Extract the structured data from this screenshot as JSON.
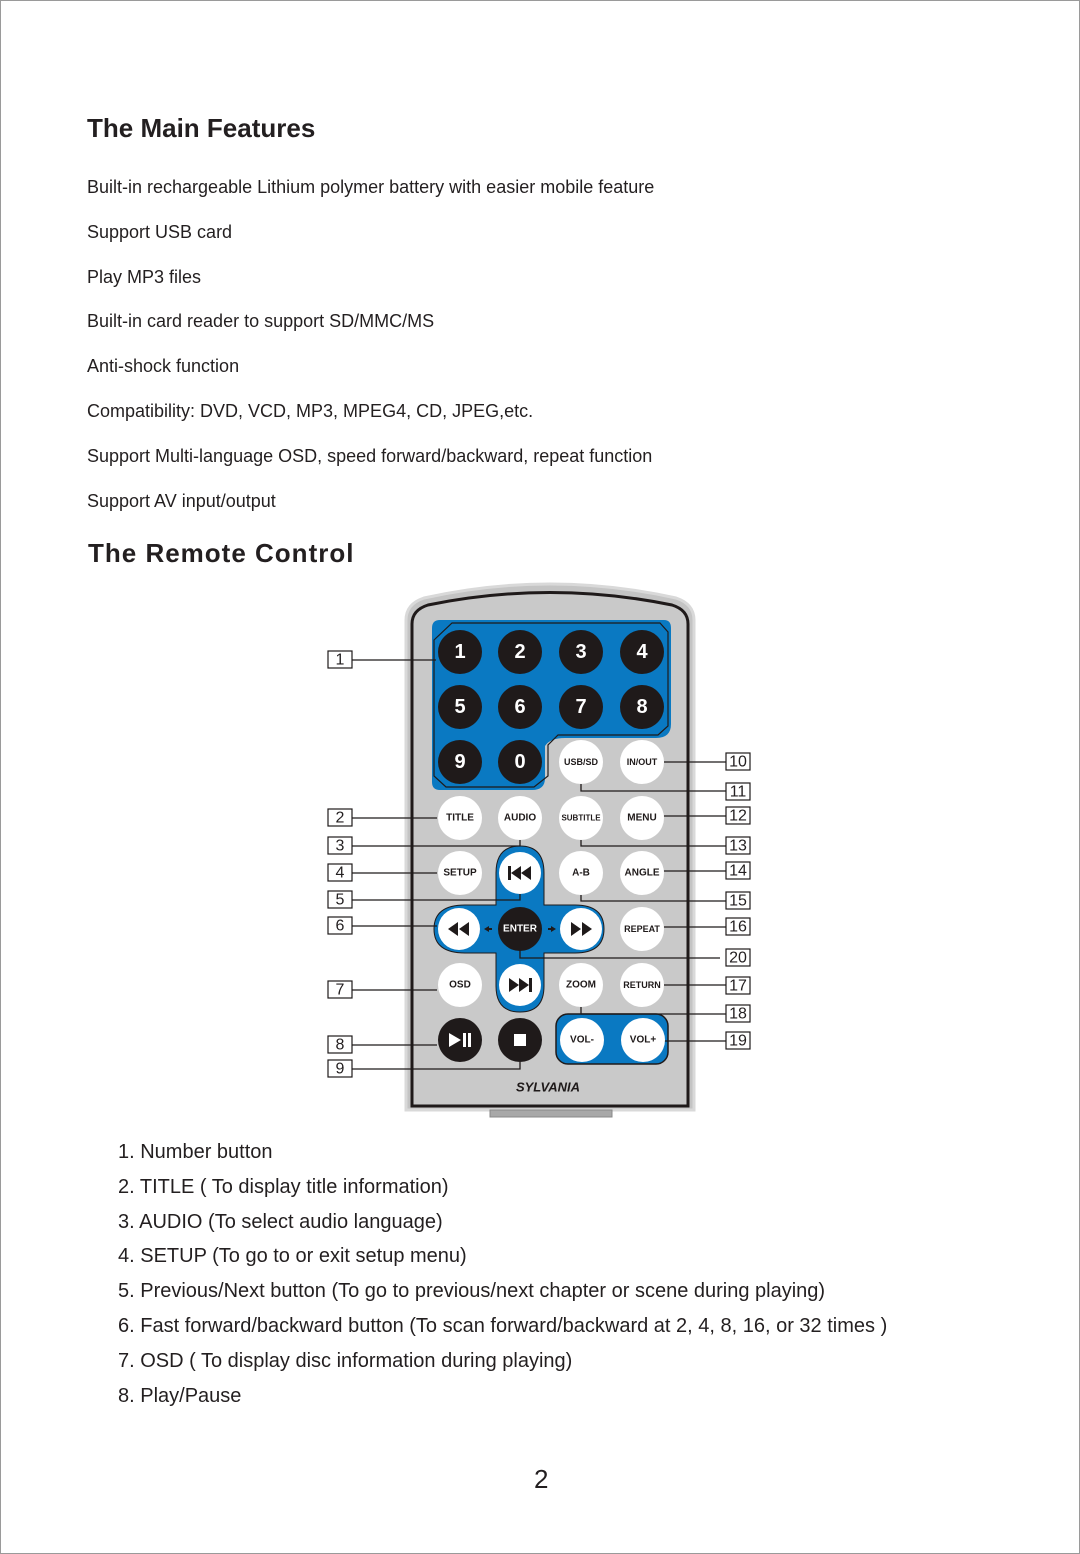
{
  "features": {
    "title": "The Main Features",
    "items": [
      "Built-in rechargeable Lithium polymer battery with easier mobile feature",
      "Support USB card",
      "Play MP3 files",
      "Built-in card reader to support SD/MMC/MS",
      "Anti-shock function",
      "Compatibility: DVD, VCD, MP3, MPEG4, CD, JPEG,etc.",
      "Support Multi-language OSD, speed forward/backward, repeat function",
      "Support AV input/output"
    ]
  },
  "remote": {
    "title": "The Remote Control",
    "brand": "SYLVANIA",
    "colors": {
      "blue": "#0a79c2",
      "body": "#c9c9c9",
      "black": "#1f1a1a",
      "white": "#ffffff"
    },
    "number_buttons": [
      "1",
      "2",
      "3",
      "4",
      "5",
      "6",
      "7",
      "8",
      "9",
      "0"
    ],
    "buttons": {
      "usb_sd": "USB/SD",
      "in_out": "IN/OUT",
      "title": "TITLE",
      "audio": "AUDIO",
      "subtitle": "SUBTITLE",
      "menu": "MENU",
      "setup": "SETUP",
      "prev": "previous-icon",
      "ab": "A-B",
      "angle": "ANGLE",
      "rewind": "rewind-icon",
      "enter": "ENTER",
      "fast_forward": "fast-forward-icon",
      "repeat": "REPEAT",
      "osd": "OSD",
      "next": "next-icon",
      "zoom": "ZOOM",
      "return": "RETURN",
      "play_pause": "play-pause-icon",
      "stop": "stop-icon",
      "vol_minus": "VOL-",
      "vol_plus": "VOL+"
    },
    "callouts_left": [
      "1",
      "2",
      "3",
      "4",
      "5",
      "6",
      "7",
      "8",
      "9"
    ],
    "callouts_right": [
      "10",
      "11",
      "12",
      "13",
      "14",
      "15",
      "16",
      "20",
      "17",
      "18",
      "19"
    ]
  },
  "descriptions": [
    "1. Number button",
    "2. TITLE ( To display title information)",
    "3. AUDIO (To select audio language)",
    "4. SETUP (To go to or exit setup menu)",
    "5. Previous/Next button (To go to previous/next chapter or scene during playing)",
    "6. Fast forward/backward button (To scan forward/backward at 2, 4, 8, 16, or 32 times )",
    "7. OSD ( To display disc information during playing)",
    "8. Play/Pause"
  ],
  "page_number": "2"
}
